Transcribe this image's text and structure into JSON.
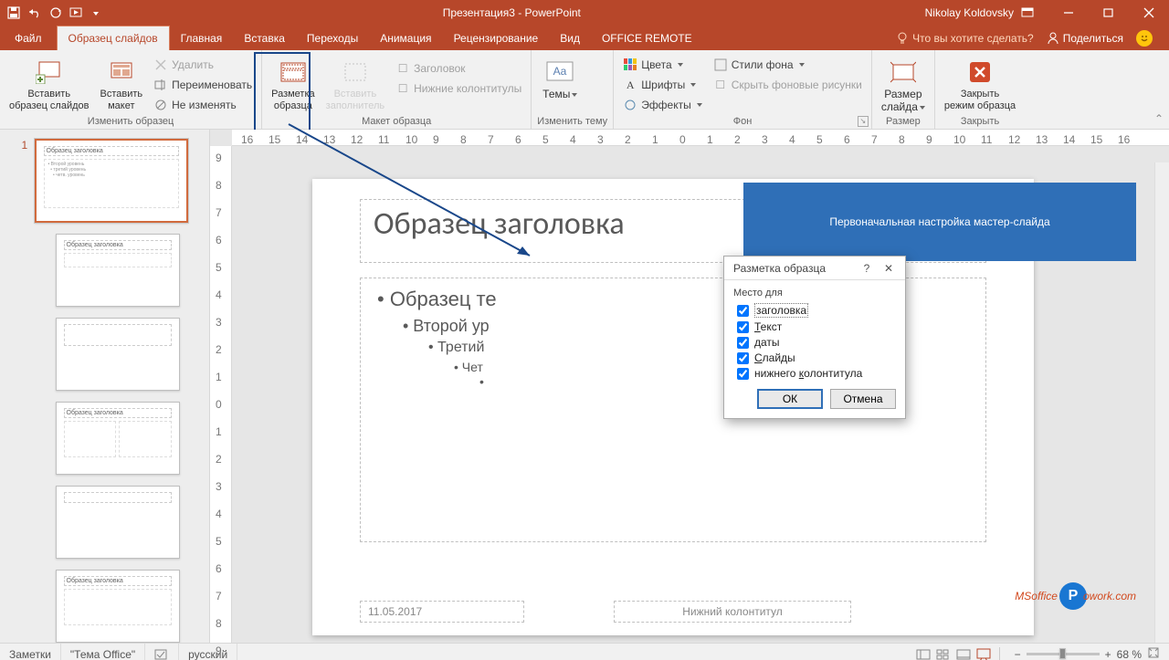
{
  "title": "Презентация3  -  PowerPoint",
  "user": "Nikolay Koldovsky",
  "tabs": {
    "file": "Файл",
    "active": "Образец слайдов",
    "items": [
      "Главная",
      "Вставка",
      "Переходы",
      "Анимация",
      "Рецензирование",
      "Вид",
      "OFFICE REMOTE"
    ],
    "tell": "Что вы хотите сделать?",
    "share": "Поделиться"
  },
  "ribbon": {
    "g1": {
      "label": "Изменить образец",
      "insertMaster": "Вставить\nобразец слайдов",
      "insertLayout": "Вставить\nмакет",
      "delete": "Удалить",
      "rename": "Переименовать",
      "preserve": "Не изменять"
    },
    "g2": {
      "label": "Макет образца",
      "layout": "Разметка\nобразца",
      "placeholder": "Вставить\nзаполнитель",
      "title": "Заголовок",
      "footers": "Нижние колонтитулы"
    },
    "g3": {
      "label": "Изменить тему",
      "themes": "Темы"
    },
    "g4": {
      "label": "Фон",
      "colors": "Цвета",
      "fonts": "Шрифты",
      "effects": "Эффекты",
      "bgstyles": "Стили фона",
      "hidebg": "Скрыть фоновые рисунки"
    },
    "g5": {
      "label": "Размер",
      "size": "Размер\nслайда"
    },
    "g6": {
      "label": "Закрыть",
      "close": "Закрыть\nрежим образца"
    }
  },
  "thumb": {
    "num": "1",
    "title": "Образец заголовка"
  },
  "slide": {
    "title": "Образец заголовка",
    "l1": "• Образец те",
    "l2": "• Второй ур",
    "l3": "• Третий",
    "l4": "• Чет",
    "date": "11.05.2017",
    "footer": "Нижний колонтитул"
  },
  "callout": "Первоначальная настройка мастер-слайда",
  "dialog": {
    "title": "Разметка образца",
    "group": "Место для",
    "items": [
      "заголовка",
      "Текст",
      "даты",
      "Слайды",
      "нижнего колонтитула"
    ],
    "ok": "ОК",
    "cancel": "Отмена"
  },
  "status": {
    "notes": "Заметки",
    "theme": "\"Тема Office\"",
    "lang": "русский",
    "zoom": "68 %"
  },
  "watermark": {
    "pre": "MSoffice",
    "mid": "P",
    "post": "owork.com"
  }
}
